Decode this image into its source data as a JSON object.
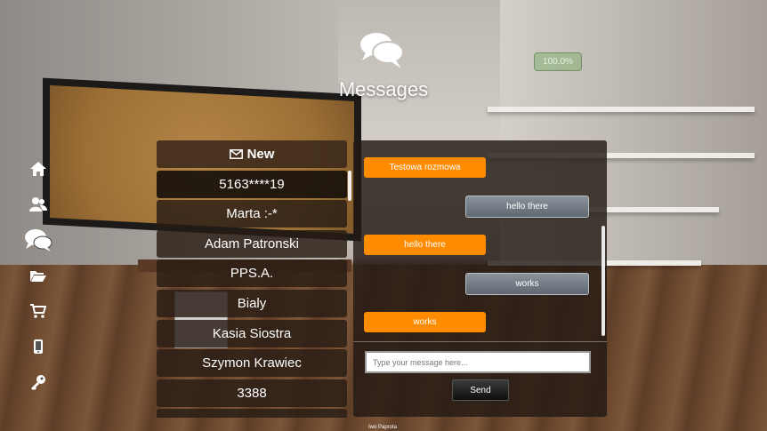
{
  "header": {
    "icon": "chat-bubbles-icon",
    "title": "Messages",
    "badge": "100.0%"
  },
  "nav": [
    {
      "name": "home",
      "icon": "home-icon"
    },
    {
      "name": "contacts",
      "icon": "users-icon"
    },
    {
      "name": "messages",
      "icon": "chat-bubbles-icon"
    },
    {
      "name": "files",
      "icon": "folder-open-icon"
    },
    {
      "name": "shop",
      "icon": "shopping-cart-icon"
    },
    {
      "name": "mobile",
      "icon": "mobile-phone-icon"
    },
    {
      "name": "key",
      "icon": "key-icon"
    }
  ],
  "contacts": {
    "new_label": "New",
    "new_icon": "envelope-icon",
    "items": [
      "5163****19",
      "Marta :-*",
      "Adam Patronski",
      "PPS.A.",
      "Bialy",
      "Kasia Siostra",
      "Szymon Krawiec",
      "3388"
    ]
  },
  "chat": {
    "messages": [
      {
        "dir": "in",
        "text": "Testowa rozmowa"
      },
      {
        "dir": "out",
        "text": "hello there"
      },
      {
        "dir": "in",
        "text": "hello there"
      },
      {
        "dir": "out",
        "text": "works"
      },
      {
        "dir": "in",
        "text": "works"
      }
    ],
    "input_placeholder": "Type your message here...",
    "send_label": "Send"
  },
  "footer": "Iwo Paprota",
  "colors": {
    "incoming": "#ff8c00",
    "outgoing": "#6f7880",
    "panel": "#231a14"
  }
}
